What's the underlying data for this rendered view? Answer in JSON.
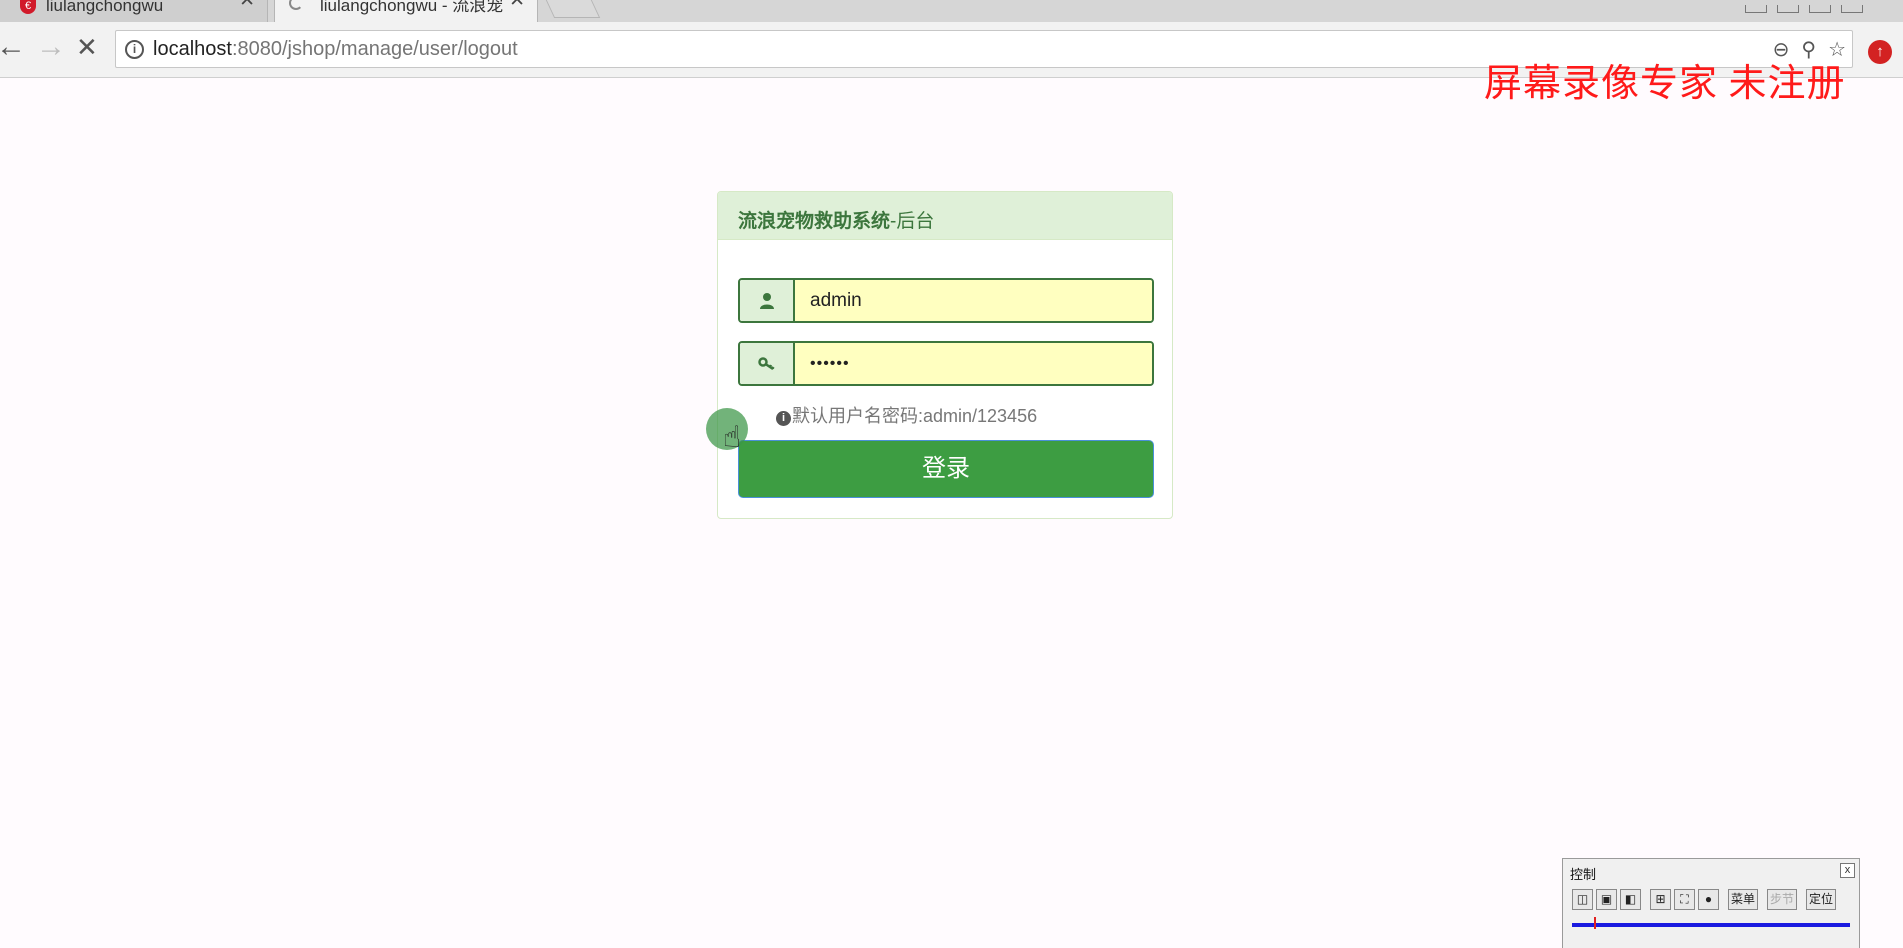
{
  "browser": {
    "tabs": [
      {
        "title": "liulangchongwu",
        "close": "✕"
      },
      {
        "title": "liulangchongwu - 流浪宠",
        "close": "✕"
      }
    ],
    "url_host": "localhost",
    "url_rest": ":8080/jshop/manage/user/logout",
    "info_icon": "i",
    "toolbar_icons": {
      "back": "back-arrow-icon",
      "forward": "forward-arrow-icon",
      "stop": "stop-icon"
    }
  },
  "watermark": "屏幕录像专家  未注册",
  "login": {
    "title_strong": "流浪宠物救助系统",
    "title_rest": "-后台",
    "username_value": "admin",
    "password_value": "••••••",
    "hint": "默认用户名密码:admin/123456",
    "button_label": "登录",
    "colors": {
      "primary": "#3d9d42",
      "heading_bg": "#dff0d8",
      "heading_text": "#3c763d",
      "field_bg": "#ffffc0"
    }
  },
  "recorder": {
    "title": "控制",
    "close": "x",
    "menu_label": "菜单",
    "step_label": "步节",
    "locate_label": "定位"
  }
}
